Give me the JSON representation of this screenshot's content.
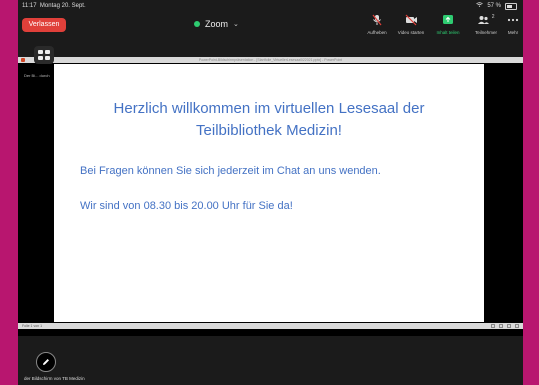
{
  "status": {
    "time": "11:17",
    "date": "Montag 20. Sept.",
    "battery": "57 %"
  },
  "topbar": {
    "leave_label": "Verlassen",
    "meeting_title": "Zoom",
    "tools": {
      "mute": "Aufheben",
      "video": "Video starten",
      "share": "Inhalt teilen",
      "participants": "Teilnehmer",
      "participants_count": "2",
      "more": "Mehr"
    }
  },
  "share": {
    "ppt_window_title": "PowerPoint-Bildschirmpräsentation - [Startfolie_VirtuellerLesesaal022021.pptx] - PowerPoint",
    "sharer_short": "Der Bi... durch",
    "slide": {
      "title_line1": "Herzlich willkommen im virtuellen Lesesaal der",
      "title_line2": "Teilbibliothek Medizin!",
      "line1": "Bei Fragen können Sie sich jederzeit im Chat an uns wenden.",
      "line2": "Wir sind von 08.30 bis 20.00 Uhr für Sie da!"
    },
    "slide_counter": "Folie 1 von 1"
  },
  "footer": {
    "screen_label": "der Bildschirm von TB Medizin"
  },
  "colors": {
    "accent_green": "#2ecc71",
    "leave_red": "#e0403a",
    "slide_text": "#4472c4",
    "frame": "#b8166f"
  }
}
